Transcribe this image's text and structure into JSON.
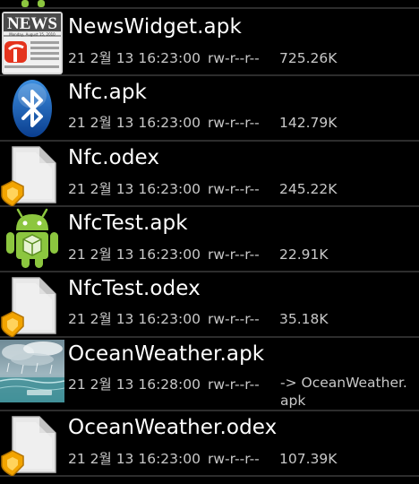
{
  "files": [
    {
      "name": "NewsWidget.apk",
      "date": "21 2월 13 16:23:00",
      "perms": "rw-r--r--",
      "size": "725.26K",
      "icon": "news-app-icon",
      "icon_text": "NEWS",
      "icon_subtext": "Monday, August 15, 2010"
    },
    {
      "name": "Nfc.apk",
      "date": "21 2월 13 16:23:00",
      "perms": "rw-r--r--",
      "size": "142.79K",
      "icon": "bluetooth-icon"
    },
    {
      "name": "Nfc.odex",
      "date": "21 2월 13 16:23:00",
      "perms": "rw-r--r--",
      "size": "245.22K",
      "icon": "secure-file-icon"
    },
    {
      "name": "NfcTest.apk",
      "date": "21 2월 13 16:23:00",
      "perms": "rw-r--r--",
      "size": "22.91K",
      "icon": "android-robot-icon"
    },
    {
      "name": "NfcTest.odex",
      "date": "21 2월 13 16:23:00",
      "perms": "rw-r--r--",
      "size": "35.18K",
      "icon": "secure-file-icon"
    },
    {
      "name": "OceanWeather.apk",
      "date": "21 2월 13 16:28:00",
      "perms": "rw-r--r--",
      "link_line1": "-> OceanWeather.",
      "link_line2": "apk",
      "icon": "ocean-weather-icon"
    },
    {
      "name": "OceanWeather.odex",
      "date": "21 2월 13 16:23:00",
      "perms": "rw-r--r--",
      "size": "107.39K",
      "icon": "secure-file-icon"
    }
  ],
  "colors": {
    "background": "#000000",
    "divider": "#2d2d2d",
    "primary_text": "#ffffff",
    "secondary_text": "#c8c8c8"
  }
}
